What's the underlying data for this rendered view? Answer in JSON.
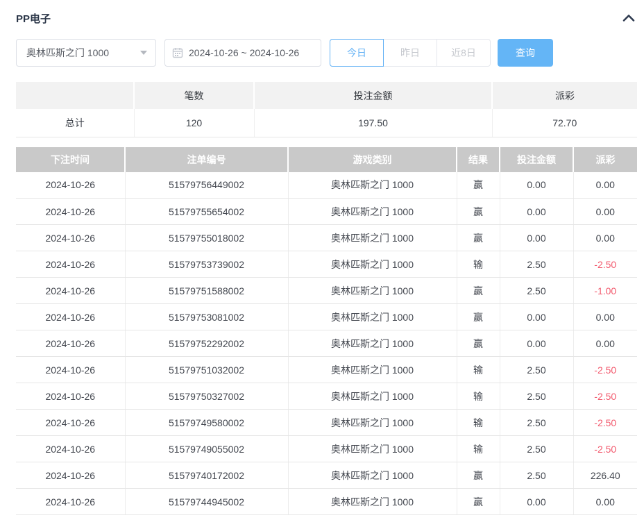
{
  "page": {
    "title": "PP电子"
  },
  "icons": {
    "collapse": "chevron-up-icon",
    "select_caret": "caret-down-icon",
    "calendar": "calendar-icon"
  },
  "colors": {
    "accent_blue": "#64b5f6",
    "active_border_blue": "#64b2f5",
    "negative_red": "#f2596d",
    "table_header_gray": "#c9c9c9",
    "summary_header_gray": "#f2f2f2"
  },
  "filters": {
    "game_select": {
      "value": "奥林匹斯之门 1000"
    },
    "date_range": {
      "value": "2024-10-26 ~ 2024-10-26"
    },
    "quick_buttons": [
      {
        "label": "今日",
        "active": true
      },
      {
        "label": "昨日",
        "active": false
      },
      {
        "label": "近8日",
        "active": false
      }
    ],
    "search_label": "查询"
  },
  "summary": {
    "headers": [
      "",
      "笔数",
      "投注金额",
      "派彩"
    ],
    "total": {
      "label": "总计",
      "count": "120",
      "bet_amount": "197.50",
      "payout": "72.70"
    }
  },
  "records": {
    "headers": [
      "下注时间",
      "注单编号",
      "游戏类别",
      "结果",
      "投注金额",
      "派彩"
    ],
    "rows": [
      {
        "date": "2024-10-26",
        "order_no": "51579756449002",
        "game": "奥林匹斯之门 1000",
        "result": "赢",
        "bet": "0.00",
        "payout": "0.00"
      },
      {
        "date": "2024-10-26",
        "order_no": "51579755654002",
        "game": "奥林匹斯之门 1000",
        "result": "赢",
        "bet": "0.00",
        "payout": "0.00"
      },
      {
        "date": "2024-10-26",
        "order_no": "51579755018002",
        "game": "奥林匹斯之门 1000",
        "result": "赢",
        "bet": "0.00",
        "payout": "0.00"
      },
      {
        "date": "2024-10-26",
        "order_no": "51579753739002",
        "game": "奥林匹斯之门 1000",
        "result": "输",
        "bet": "2.50",
        "payout": "-2.50"
      },
      {
        "date": "2024-10-26",
        "order_no": "51579751588002",
        "game": "奥林匹斯之门 1000",
        "result": "赢",
        "bet": "2.50",
        "payout": "-1.00"
      },
      {
        "date": "2024-10-26",
        "order_no": "51579753081002",
        "game": "奥林匹斯之门 1000",
        "result": "赢",
        "bet": "0.00",
        "payout": "0.00"
      },
      {
        "date": "2024-10-26",
        "order_no": "51579752292002",
        "game": "奥林匹斯之门 1000",
        "result": "赢",
        "bet": "0.00",
        "payout": "0.00"
      },
      {
        "date": "2024-10-26",
        "order_no": "51579751032002",
        "game": "奥林匹斯之门 1000",
        "result": "输",
        "bet": "2.50",
        "payout": "-2.50"
      },
      {
        "date": "2024-10-26",
        "order_no": "51579750327002",
        "game": "奥林匹斯之门 1000",
        "result": "输",
        "bet": "2.50",
        "payout": "-2.50"
      },
      {
        "date": "2024-10-26",
        "order_no": "51579749580002",
        "game": "奥林匹斯之门 1000",
        "result": "输",
        "bet": "2.50",
        "payout": "-2.50"
      },
      {
        "date": "2024-10-26",
        "order_no": "51579749055002",
        "game": "奥林匹斯之门 1000",
        "result": "输",
        "bet": "2.50",
        "payout": "-2.50"
      },
      {
        "date": "2024-10-26",
        "order_no": "51579740172002",
        "game": "奥林匹斯之门 1000",
        "result": "赢",
        "bet": "2.50",
        "payout": "226.40"
      },
      {
        "date": "2024-10-26",
        "order_no": "51579744945002",
        "game": "奥林匹斯之门 1000",
        "result": "赢",
        "bet": "0.00",
        "payout": "0.00"
      }
    ]
  }
}
